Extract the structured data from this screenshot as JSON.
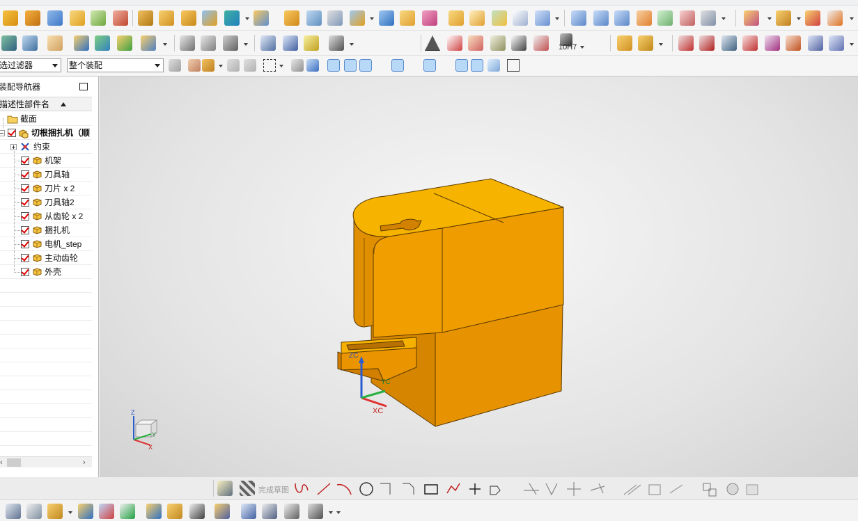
{
  "toolbar": {
    "selection_filter": "选过滤器",
    "assembly_scope": "整个装配",
    "fit_label": "10H7",
    "finish_sketch": "完成草图"
  },
  "navigator": {
    "title": "装配导航器",
    "column_header": "描述性部件名",
    "section": "截面",
    "root": "切根捆扎机（顺",
    "constraints": "约束",
    "parts": [
      "机架",
      "刀具轴",
      "刀片 x 2",
      "刀具轴2",
      "从齿轮 x 2",
      "捆扎机",
      "电机_step",
      "主动齿轮",
      "外壳"
    ]
  },
  "viewport": {
    "csys_labels": {
      "x": "XC",
      "y": "YC",
      "z": "ZC"
    },
    "triad_labels": {
      "x": "X",
      "y": "Y",
      "z": "Z"
    }
  },
  "colors": {
    "model_top": "#f5b400",
    "model_front": "#f0a000",
    "model_side": "#e89300",
    "model_dark": "#d18200",
    "edge": "#5a3a00",
    "check": "#e00000"
  }
}
